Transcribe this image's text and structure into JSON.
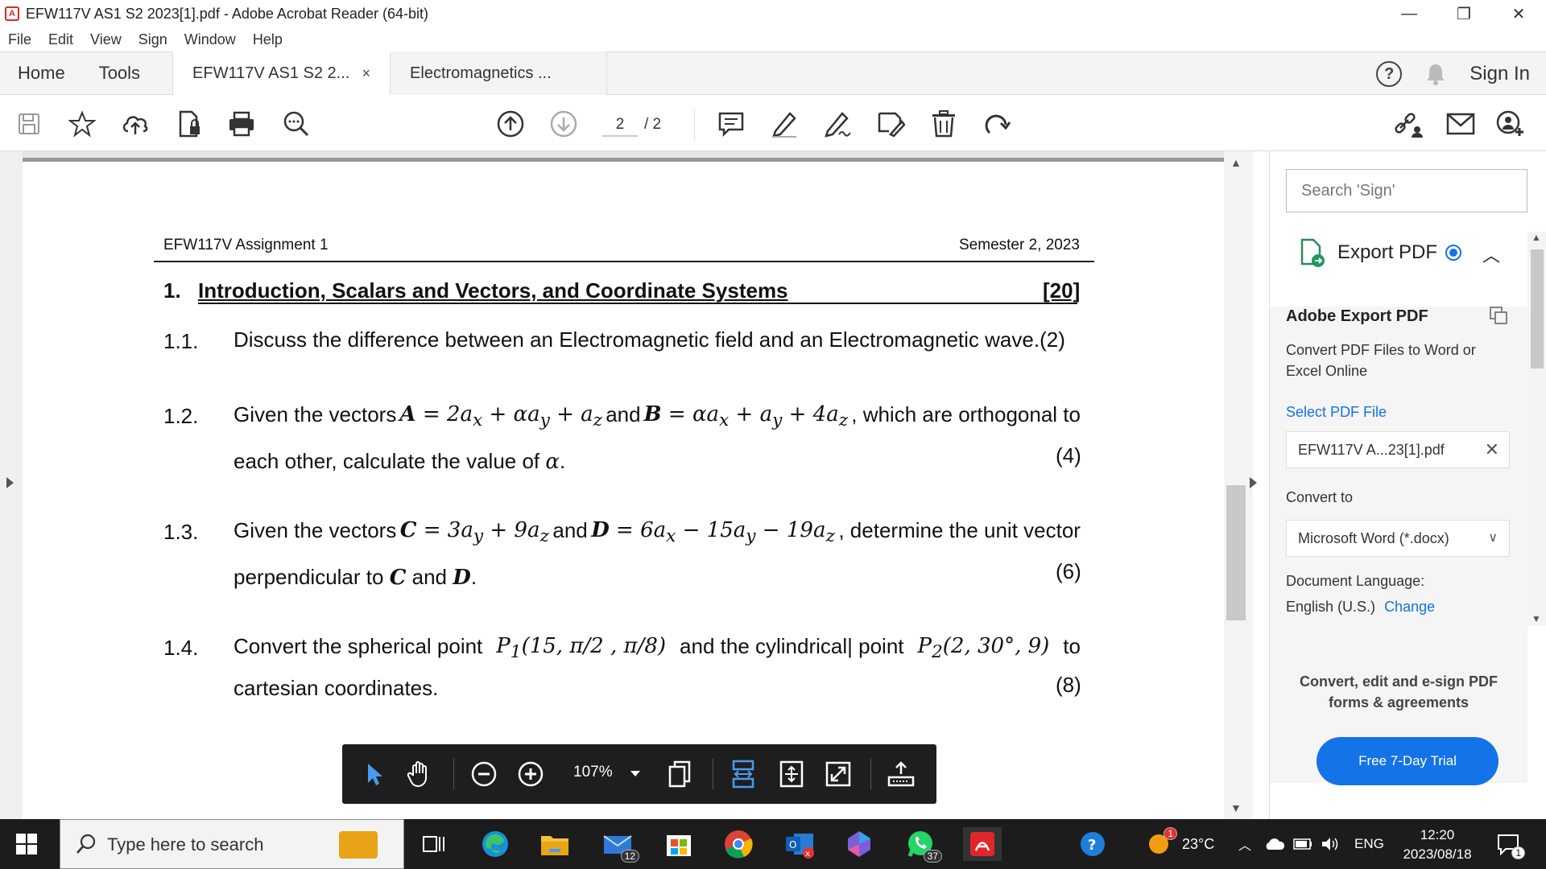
{
  "window": {
    "title": "EFW117V AS1 S2 2023[1].pdf - Adobe Acrobat Reader (64-bit)",
    "controls": [
      "—",
      "❐",
      "✕"
    ]
  },
  "menu": [
    "File",
    "Edit",
    "View",
    "Sign",
    "Window",
    "Help"
  ],
  "tabs": {
    "home": "Home",
    "tools": "Tools",
    "docs": [
      {
        "label": "EFW117V AS1 S2 2...",
        "close": "×"
      },
      {
        "label": "Electromagnetics ..."
      }
    ],
    "help": "?",
    "signin": "Sign In"
  },
  "toolbar": {
    "page_current": "2",
    "page_total": "/ 2"
  },
  "document": {
    "header_left": "EFW117V Assignment 1",
    "header_right": "Semester 2, 2023",
    "section_num": "1.",
    "section_title": "Introduction, Scalars and Vectors, and Coordinate Systems",
    "section_marks": "[20]",
    "questions": [
      {
        "num": "1.1.",
        "text": "Discuss the difference between an Electromagnetic field and an Electromagnetic wave.(2)"
      },
      {
        "num": "1.2.",
        "line1_a": "Given the vectors",
        "line1_A": "A",
        "line1_eqA": " = 2a",
        "line1_b": "and",
        "line1_B": "B",
        "line1_c": ", which are orthogonal to",
        "line2": "each other, calculate the value of",
        "alpha": "α",
        "marks": "(4)"
      },
      {
        "num": "1.3.",
        "line1_a": "Given the vectors",
        "line1_b": "and",
        "line1_c": ", determine the unit vector",
        "line2_a": "perpendicular to",
        "line2_b": "and",
        "marks": "(6)"
      },
      {
        "num": "1.4.",
        "line1_a": "Convert the spherical point",
        "line1_b": "and the cylindrical| point",
        "line1_c": "to",
        "line2": "cartesian coordinates.",
        "marks": "(8)"
      }
    ]
  },
  "zoom": {
    "value": "107%"
  },
  "rightpane": {
    "search_placeholder": "Search 'Sign'",
    "export_label": "Export PDF",
    "heading": "Adobe Export PDF",
    "desc": "Convert PDF Files to Word or Excel Online",
    "select_link": "Select PDF File",
    "file_name": "EFW117V A...23[1].pdf",
    "convert_to_label": "Convert to",
    "convert_to_value": "Microsoft Word (*.docx)",
    "doc_lang_label": "Document Language:",
    "doc_lang_value": "English (U.S.)",
    "change": "Change",
    "promo": "Convert, edit and e-sign PDF forms & agreements",
    "trial_button": "Free 7-Day Trial"
  },
  "taskbar": {
    "search_text": "Type here to search",
    "mail_badge": "12",
    "whatsapp_badge": "37",
    "weather_badge": "1",
    "temperature": "23°C",
    "lang": "ENG",
    "time": "12:20",
    "date": "2023/08/18",
    "notif_badge": "1"
  }
}
